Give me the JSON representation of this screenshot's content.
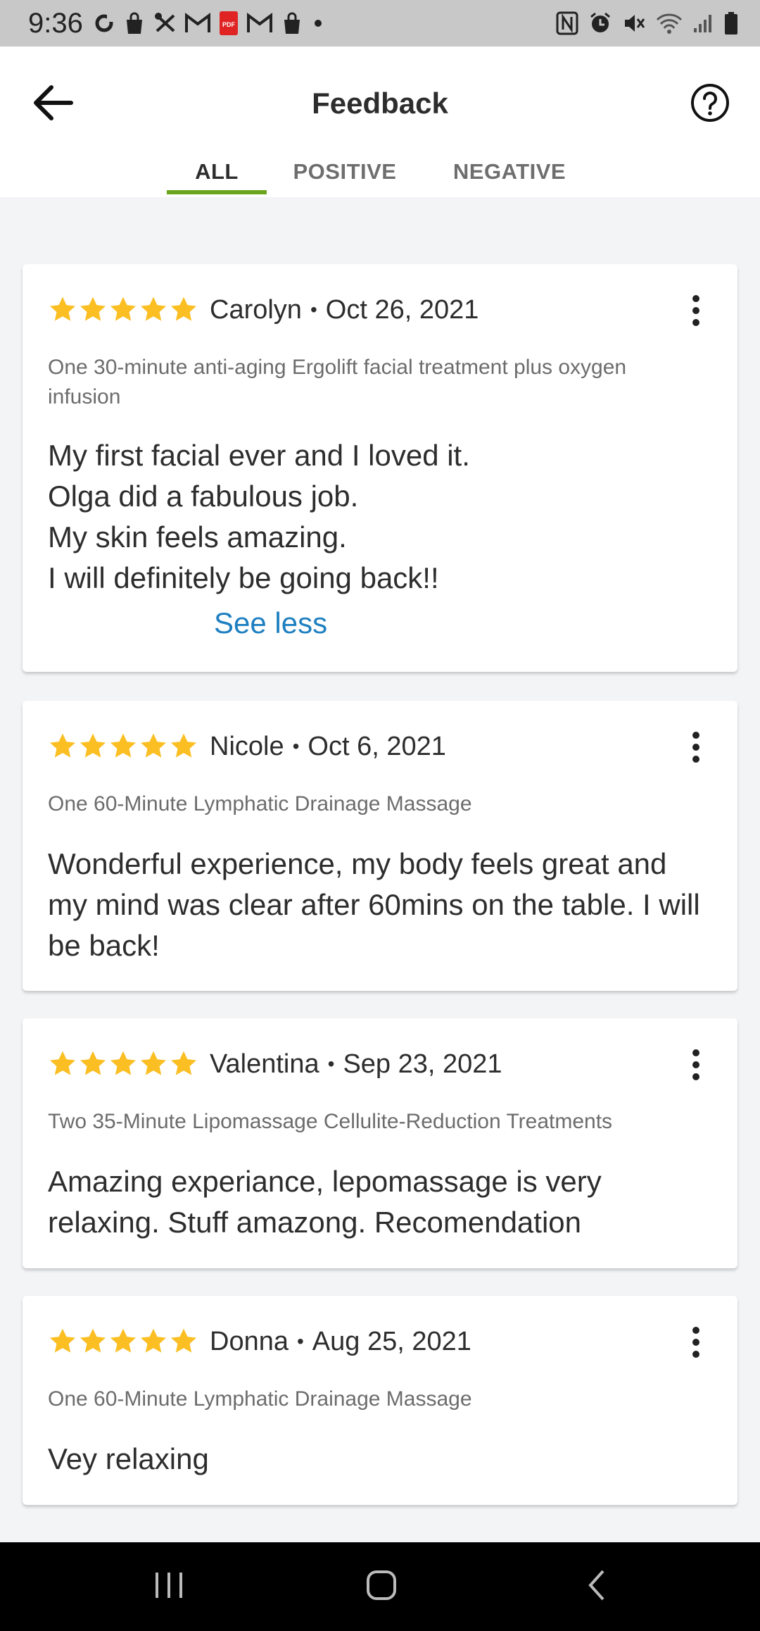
{
  "status_bar": {
    "time": "9:36",
    "left_icons": [
      "sync-icon",
      "shopping-bag-icon",
      "tools-icon",
      "gmail-icon",
      "pdf-icon",
      "gmail-icon",
      "shopping-bag-icon",
      "dot-icon"
    ],
    "right_icons": [
      "nfc-icon",
      "alarm-icon",
      "mute-icon",
      "wifi-icon",
      "signal-icon",
      "battery-icon"
    ]
  },
  "header": {
    "title": "Feedback",
    "back_icon": "arrow-left-icon",
    "help_icon": "help-circle-icon"
  },
  "tabs": [
    {
      "label": "ALL",
      "active": true
    },
    {
      "label": "POSITIVE",
      "active": false
    },
    {
      "label": "NEGATIVE",
      "active": false
    }
  ],
  "accent_color": "#6aa51d",
  "star_color": "#fbbf24",
  "link_color": "#1e7fc0",
  "reviews": [
    {
      "rating": 5,
      "name": "Carolyn",
      "separator": "•",
      "date": "Oct 26, 2021",
      "service": "One 30-minute anti-aging Ergolift facial treatment plus oxygen infusion",
      "text": "My first facial ever and I loved it.\nOlga did a fabulous job.\nMy skin feels amazing.\nI will definitely be going back!!",
      "toggle": "See less"
    },
    {
      "rating": 5,
      "name": "Nicole",
      "separator": "•",
      "date": "Oct 6, 2021",
      "service": "One 60-Minute Lymphatic Drainage Massage",
      "text": "Wonderful experience, my body feels great and my mind was clear after 60mins on the table.  I will be back!"
    },
    {
      "rating": 5,
      "name": "Valentina",
      "separator": "•",
      "date": "Sep 23, 2021",
      "service": "Two 35-Minute Lipomassage Cellulite-Reduction Treatments",
      "text": "Amazing experiance, lepomassage is very relaxing. Stuff amazong. Recomendation"
    },
    {
      "rating": 5,
      "name": "Donna",
      "separator": "•",
      "date": "Aug 25, 2021",
      "service": "One 60-Minute Lymphatic Drainage Massage",
      "text": "Vey relaxing"
    }
  ],
  "nav_bar": {
    "recents_icon": "recents-icon",
    "home_icon": "home-icon",
    "back_icon": "back-chevron-icon"
  }
}
